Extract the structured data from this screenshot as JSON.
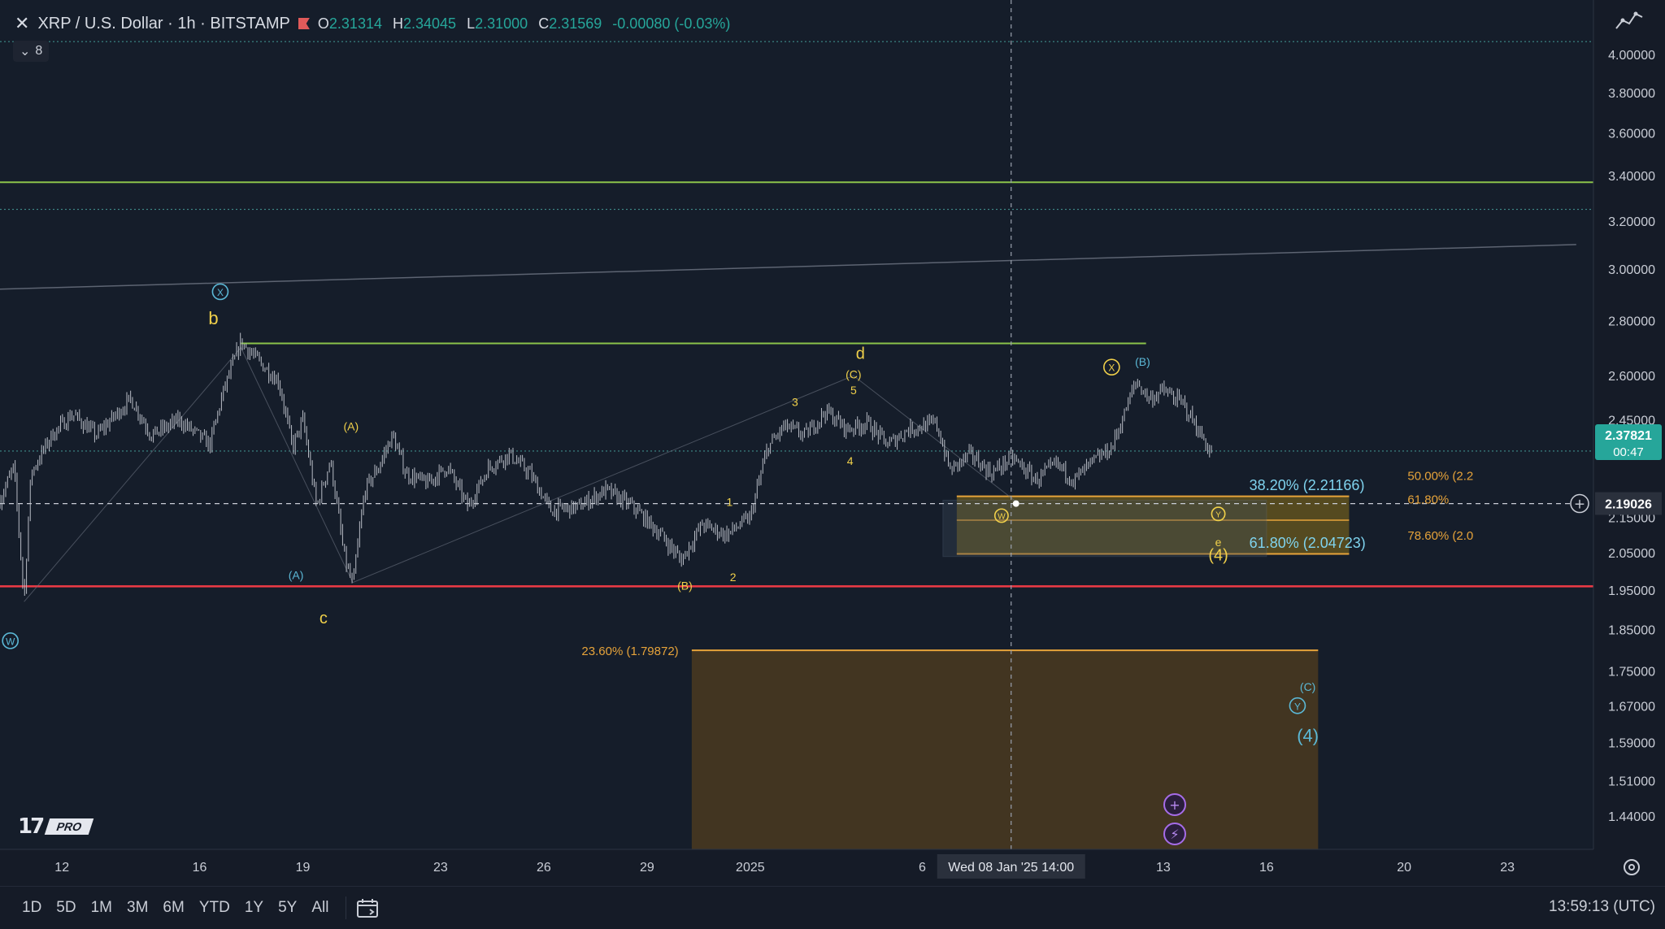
{
  "header": {
    "close_glyph": "✕",
    "title": "XRP / U.S. Dollar · 1h · BITSTAMP",
    "ohlc": {
      "o_label": "O",
      "o": "2.31314",
      "h_label": "H",
      "h": "2.34045",
      "l_label": "L",
      "l": "2.31000",
      "c_label": "C",
      "c": "2.31569",
      "change": "-0.00080 (-0.03%)"
    }
  },
  "indicators_toggle": {
    "glyph": "⌄",
    "count": "8"
  },
  "logo": {
    "mark": "17",
    "badge": "PRO"
  },
  "timeframes": [
    "1D",
    "5D",
    "1M",
    "3M",
    "6M",
    "YTD",
    "1Y",
    "5Y",
    "All"
  ],
  "clock": "13:59:13 (UTC)",
  "colors": {
    "background": "#151b27",
    "candle": "#b9bdc6",
    "green_line": "#8bc34a",
    "red_line": "#ef3b46",
    "wave_yellow": "#f0d04a",
    "wave_blue": "#5bb8d6",
    "fib_orange": "#e6a33a",
    "price_badge": "#26a69a"
  },
  "chart_data": {
    "type": "candlestick",
    "symbol": "XRP / U.S. Dollar",
    "interval": "1h",
    "exchange": "BITSTAMP",
    "y_axis": {
      "ticks": [
        "4.00000",
        "3.80000",
        "3.60000",
        "3.40000",
        "3.20000",
        "3.00000",
        "2.80000",
        "2.60000",
        "2.45000",
        "2.35000",
        "2.15000",
        "2.05000",
        "1.95000",
        "1.85000",
        "1.75000",
        "1.67000",
        "1.59000",
        "1.51000",
        "1.44000"
      ],
      "log": true,
      "range": [
        1.4,
        4.12
      ]
    },
    "x_axis": {
      "ticks": [
        {
          "label": "12",
          "t": 0.0
        },
        {
          "label": "16",
          "t": 4.0
        },
        {
          "label": "19",
          "t": 7.0
        },
        {
          "label": "23",
          "t": 11.0
        },
        {
          "label": "26",
          "t": 14.0
        },
        {
          "label": "29",
          "t": 17.0
        },
        {
          "label": "2025",
          "t": 20.0
        },
        {
          "label": "6",
          "t": 25.0
        },
        {
          "label": "13",
          "t": 32.0
        },
        {
          "label": "16",
          "t": 35.0
        },
        {
          "label": "20",
          "t": 39.0
        },
        {
          "label": "23",
          "t": 42.0
        }
      ],
      "range": [
        -1.8,
        44.5
      ],
      "crosshair_label": "Wed 08 Jan '25   14:00",
      "crosshair_t": 27.58
    },
    "price_path": [
      {
        "t": -1.8,
        "p": 2.2
      },
      {
        "t": -1.4,
        "p": 2.3
      },
      {
        "t": -1.1,
        "p": 1.92
      },
      {
        "t": -0.9,
        "p": 2.28
      },
      {
        "t": -0.3,
        "p": 2.4
      },
      {
        "t": 0.3,
        "p": 2.47
      },
      {
        "t": 1.0,
        "p": 2.4
      },
      {
        "t": 2.0,
        "p": 2.52
      },
      {
        "t": 2.6,
        "p": 2.4
      },
      {
        "t": 3.4,
        "p": 2.45
      },
      {
        "t": 4.3,
        "p": 2.37
      },
      {
        "t": 4.7,
        "p": 2.55
      },
      {
        "t": 5.2,
        "p": 2.72
      },
      {
        "t": 5.8,
        "p": 2.64
      },
      {
        "t": 6.3,
        "p": 2.58
      },
      {
        "t": 6.7,
        "p": 2.36
      },
      {
        "t": 7.0,
        "p": 2.45
      },
      {
        "t": 7.4,
        "p": 2.18
      },
      {
        "t": 7.8,
        "p": 2.32
      },
      {
        "t": 8.2,
        "p": 2.04
      },
      {
        "t": 8.45,
        "p": 1.96
      },
      {
        "t": 8.8,
        "p": 2.23
      },
      {
        "t": 9.2,
        "p": 2.3
      },
      {
        "t": 9.6,
        "p": 2.4
      },
      {
        "t": 10.0,
        "p": 2.28
      },
      {
        "t": 10.6,
        "p": 2.25
      },
      {
        "t": 11.2,
        "p": 2.3
      },
      {
        "t": 11.8,
        "p": 2.18
      },
      {
        "t": 12.4,
        "p": 2.3
      },
      {
        "t": 13.0,
        "p": 2.34
      },
      {
        "t": 13.6,
        "p": 2.28
      },
      {
        "t": 14.2,
        "p": 2.17
      },
      {
        "t": 15.0,
        "p": 2.18
      },
      {
        "t": 15.8,
        "p": 2.23
      },
      {
        "t": 16.6,
        "p": 2.18
      },
      {
        "t": 17.4,
        "p": 2.1
      },
      {
        "t": 18.0,
        "p": 2.03
      },
      {
        "t": 18.6,
        "p": 2.13
      },
      {
        "t": 19.3,
        "p": 2.1
      },
      {
        "t": 20.0,
        "p": 2.15
      },
      {
        "t": 20.5,
        "p": 2.36
      },
      {
        "t": 21.0,
        "p": 2.43
      },
      {
        "t": 21.6,
        "p": 2.4
      },
      {
        "t": 22.2,
        "p": 2.48
      },
      {
        "t": 22.8,
        "p": 2.42
      },
      {
        "t": 23.4,
        "p": 2.44
      },
      {
        "t": 24.0,
        "p": 2.37
      },
      {
        "t": 24.6,
        "p": 2.42
      },
      {
        "t": 25.4,
        "p": 2.44
      },
      {
        "t": 25.8,
        "p": 2.29
      },
      {
        "t": 26.4,
        "p": 2.34
      },
      {
        "t": 27.0,
        "p": 2.28
      },
      {
        "t": 27.6,
        "p": 2.33
      },
      {
        "t": 28.3,
        "p": 2.26
      },
      {
        "t": 28.9,
        "p": 2.31
      },
      {
        "t": 29.4,
        "p": 2.26
      },
      {
        "t": 30.0,
        "p": 2.32
      },
      {
        "t": 30.5,
        "p": 2.36
      },
      {
        "t": 30.9,
        "p": 2.48
      },
      {
        "t": 31.2,
        "p": 2.58
      },
      {
        "t": 31.6,
        "p": 2.52
      },
      {
        "t": 32.0,
        "p": 2.55
      },
      {
        "t": 32.6,
        "p": 2.5
      },
      {
        "t": 33.0,
        "p": 2.42
      },
      {
        "t": 33.4,
        "p": 2.34
      }
    ],
    "levels": [
      {
        "price": 4.07,
        "style": "teal-dotted"
      },
      {
        "price": 3.37,
        "style": "green"
      },
      {
        "price": 3.25,
        "style": "teal-dotted"
      },
      {
        "price": 2.35,
        "style": "teal-dotted"
      },
      {
        "price": 1.96,
        "style": "red"
      }
    ],
    "segments": [
      {
        "t1": 5.2,
        "p1": 2.715,
        "t2": 31.5,
        "p2": 2.715,
        "style": "green"
      },
      {
        "t1": -1.8,
        "p1": 2.92,
        "t2": 44.0,
        "p2": 3.1,
        "style": "gray"
      },
      {
        "t1": -1.1,
        "p1": 1.92,
        "t2": 5.2,
        "p2": 2.7,
        "style": "gray-thin"
      },
      {
        "t1": 5.2,
        "p1": 2.7,
        "t2": 8.45,
        "p2": 1.97,
        "style": "gray-thin"
      },
      {
        "t1": 8.45,
        "p1": 1.97,
        "t2": 23.0,
        "p2": 2.6,
        "style": "gray-thin"
      },
      {
        "t1": 23.0,
        "p1": 2.6,
        "t2": 27.8,
        "p2": 2.19,
        "style": "gray-thin"
      },
      {
        "t1": -1.8,
        "p1": 2.19,
        "t2": 44.0,
        "p2": 2.19,
        "style": "white-dashed"
      }
    ],
    "zones": [
      {
        "t1": 26.0,
        "t2": 37.4,
        "p_top": 2.21166,
        "p_bottom": 2.04723,
        "kind": "fib-yellow"
      },
      {
        "t1": 25.6,
        "t2": 35.0,
        "p_top": 2.2,
        "p_bottom": 2.04,
        "kind": "gray-box"
      },
      {
        "t1": 18.3,
        "t2": 36.5,
        "p_top": 1.79872,
        "p_bottom": 1.4,
        "kind": "fib-orange"
      }
    ],
    "fib_labels": [
      {
        "text": "38.20% (2.21166)",
        "t": 34.5,
        "p": 2.245,
        "color": "blue"
      },
      {
        "text": "61.80% (2.04723)",
        "t": 34.5,
        "p": 2.078,
        "color": "blue"
      },
      {
        "text": "50.00% (2.2",
        "t": 39.1,
        "p": 2.275,
        "color": "orange"
      },
      {
        "text": "61.80%",
        "t": 39.1,
        "p": 2.205,
        "color": "orange"
      },
      {
        "text": "78.60% (2.0",
        "t": 39.1,
        "p": 2.1,
        "color": "orange"
      },
      {
        "text": "23.60% (1.79872)",
        "t": 15.1,
        "p": 1.799,
        "color": "orange"
      }
    ],
    "wave_labels": [
      {
        "text": "b",
        "t": 4.4,
        "p": 2.81,
        "color": "yellow",
        "circle": false,
        "size": 22
      },
      {
        "text": "X",
        "t": 4.6,
        "p": 2.91,
        "color": "blue",
        "circle": true,
        "size": 14
      },
      {
        "text": "(A)",
        "t": 8.4,
        "p": 2.43,
        "color": "yellow",
        "circle": false,
        "size": 14
      },
      {
        "text": "(A)",
        "t": 6.8,
        "p": 1.99,
        "color": "blue",
        "circle": false,
        "size": 14
      },
      {
        "text": "c",
        "t": 7.6,
        "p": 1.88,
        "color": "yellow",
        "circle": false,
        "size": 20
      },
      {
        "text": "W",
        "t": -1.5,
        "p": 1.822,
        "color": "blue",
        "circle": true,
        "size": 14
      },
      {
        "text": "1",
        "t": 19.4,
        "p": 2.195,
        "color": "yellow",
        "circle": false,
        "size": 14
      },
      {
        "text": "2",
        "t": 19.5,
        "p": 1.985,
        "color": "yellow",
        "circle": false,
        "size": 14
      },
      {
        "text": "(B)",
        "t": 18.1,
        "p": 1.962,
        "color": "yellow",
        "circle": false,
        "size": 14
      },
      {
        "text": "3",
        "t": 21.3,
        "p": 2.51,
        "color": "yellow",
        "circle": false,
        "size": 14
      },
      {
        "text": "4",
        "t": 22.9,
        "p": 2.32,
        "color": "yellow",
        "circle": false,
        "size": 14
      },
      {
        "text": "5",
        "t": 23.0,
        "p": 2.55,
        "color": "yellow",
        "circle": false,
        "size": 14
      },
      {
        "text": "(C)",
        "t": 23.0,
        "p": 2.605,
        "color": "yellow",
        "circle": false,
        "size": 14
      },
      {
        "text": "d",
        "t": 23.2,
        "p": 2.68,
        "color": "yellow",
        "circle": false,
        "size": 20
      },
      {
        "text": "X",
        "t": 30.5,
        "p": 2.63,
        "color": "yellow",
        "circle": true,
        "size": 14
      },
      {
        "text": "(B)",
        "t": 31.4,
        "p": 2.65,
        "color": "blue",
        "circle": false,
        "size": 14
      },
      {
        "text": "W",
        "t": 27.3,
        "p": 2.155,
        "color": "yellow",
        "circle": true,
        "size": 12
      },
      {
        "text": "Y",
        "t": 33.6,
        "p": 2.16,
        "color": "yellow",
        "circle": true,
        "size": 12
      },
      {
        "text": "e",
        "t": 33.6,
        "p": 2.08,
        "color": "yellow",
        "circle": false,
        "size": 14
      },
      {
        "text": "(4)",
        "t": 33.6,
        "p": 2.045,
        "color": "yellow",
        "circle": false,
        "size": 20
      },
      {
        "text": "(C)",
        "t": 36.2,
        "p": 1.713,
        "color": "blue",
        "circle": false,
        "size": 14
      },
      {
        "text": "Y",
        "t": 35.9,
        "p": 1.67,
        "color": "blue",
        "circle": true,
        "size": 14
      },
      {
        "text": "(4)",
        "t": 36.2,
        "p": 1.605,
        "color": "blue",
        "circle": false,
        "size": 22
      }
    ],
    "current_price": {
      "value": "2.37821",
      "countdown": "00:47",
      "p": 2.37821
    },
    "crosshair_price": {
      "value": "2.19026",
      "p": 2.19026
    }
  }
}
